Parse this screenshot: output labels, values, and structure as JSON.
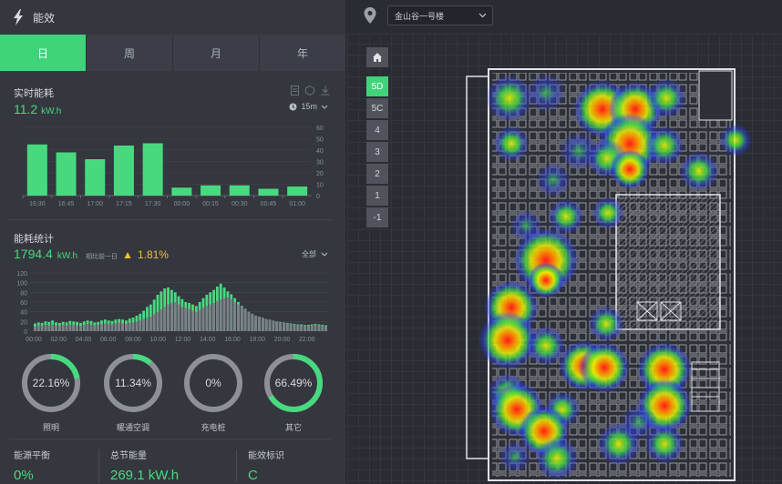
{
  "header": {
    "title": "能效"
  },
  "tabs": [
    {
      "label": "日",
      "active": true
    },
    {
      "label": "周",
      "active": false
    },
    {
      "label": "月",
      "active": false
    },
    {
      "label": "年",
      "active": false
    }
  ],
  "realtime": {
    "title": "实时能耗",
    "value": "11.2",
    "unit": "kW.h",
    "interval": "15m",
    "chart_data": {
      "type": "bar",
      "categories": [
        "16:30",
        "16:45",
        "17:00",
        "17:15",
        "17:30",
        "00:00",
        "00:15",
        "00:30",
        "00:45",
        "01:00"
      ],
      "values": [
        45,
        38,
        32,
        44,
        46,
        7,
        9,
        9,
        6,
        8
      ],
      "ylim": [
        0,
        60
      ],
      "yticks": [
        0,
        10,
        20,
        30,
        40,
        50,
        60
      ],
      "color": "#48d97f"
    }
  },
  "stats": {
    "title": "能耗统计",
    "value": "1794.4",
    "unit": "kW.h",
    "compare_label": "相比前一日",
    "compare_value": "1.81%",
    "filter": "全部",
    "chart_data": {
      "type": "bar",
      "xticks": [
        "00:00",
        "02:00",
        "04:00",
        "06:00",
        "08:00",
        "10:00",
        "12:00",
        "14:00",
        "16:00",
        "18:00",
        "20:00",
        "22:00"
      ],
      "ylim": [
        0,
        120
      ],
      "yticks": [
        0,
        20,
        40,
        60,
        80,
        100,
        120
      ],
      "series": [
        {
          "values": [
            10,
            12,
            11,
            13,
            12,
            14,
            12,
            11,
            13,
            12,
            14,
            13,
            12,
            11,
            13,
            15,
            14,
            12,
            13,
            15,
            16,
            15,
            14,
            16,
            17,
            16,
            15,
            17,
            18,
            20,
            22,
            25,
            28,
            30,
            35,
            40,
            45,
            50,
            55,
            58,
            60,
            55,
            50,
            48,
            45,
            42,
            40,
            44,
            48,
            52,
            55,
            58,
            62,
            65,
            68,
            70,
            66,
            60,
            55,
            50,
            45,
            40,
            36,
            32,
            30,
            28,
            25,
            24,
            22,
            20,
            18,
            17,
            16,
            15,
            14,
            13,
            12,
            12,
            11,
            12,
            13,
            12,
            11,
            10
          ]
        },
        {
          "values": [
            16,
            18,
            17,
            20,
            19,
            22,
            18,
            17,
            19,
            18,
            21,
            20,
            19,
            17,
            20,
            22,
            21,
            18,
            19,
            22,
            24,
            22,
            21,
            24,
            25,
            24,
            22,
            26,
            28,
            32,
            36,
            42,
            50,
            55,
            65,
            75,
            82,
            88,
            90,
            85,
            80,
            72,
            66,
            60,
            58,
            55,
            52,
            60,
            68,
            75,
            80,
            85,
            92,
            98,
            90,
            82,
            76,
            68,
            60,
            52,
            46,
            40,
            35,
            30,
            28,
            26,
            24,
            22,
            21,
            20,
            19,
            18,
            17,
            16,
            15,
            14,
            14,
            13,
            13,
            14,
            15,
            14,
            13,
            12
          ]
        }
      ],
      "colors": [
        "#7d8089",
        "#48d97f"
      ]
    }
  },
  "rings": [
    {
      "percent": "22.16%",
      "value": 22.16,
      "label": "照明"
    },
    {
      "percent": "11.34%",
      "value": 11.34,
      "label": "暖通空调"
    },
    {
      "percent": "0%",
      "value": 0,
      "label": "充电桩"
    },
    {
      "percent": "66.49%",
      "value": 66.49,
      "label": "其它"
    }
  ],
  "bottom": [
    {
      "label": "能源平衡",
      "value": "0%"
    },
    {
      "label": "总节能量",
      "value": "269.1 kW.h"
    },
    {
      "label": "能效标识",
      "value": "C"
    }
  ],
  "map": {
    "building": "金山谷一号楼",
    "floors": [
      {
        "label": "5D",
        "active": true
      },
      {
        "label": "5C",
        "active": false
      },
      {
        "label": "4",
        "active": false
      },
      {
        "label": "3",
        "active": false
      },
      {
        "label": "2",
        "active": false
      },
      {
        "label": "1",
        "active": false
      },
      {
        "label": "-1",
        "active": false
      }
    ]
  }
}
